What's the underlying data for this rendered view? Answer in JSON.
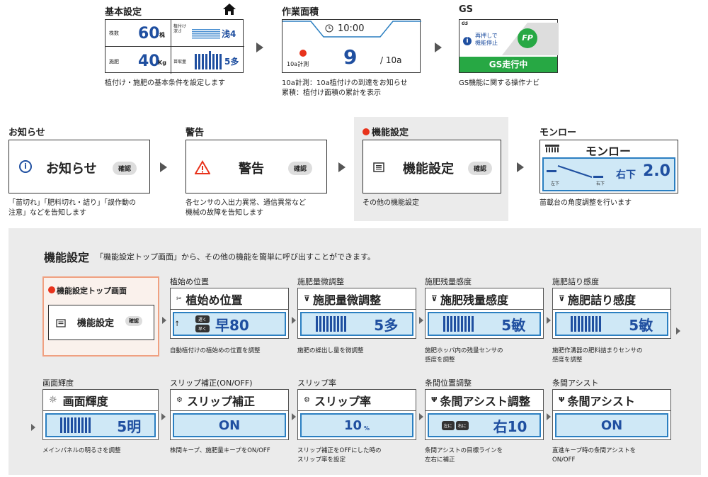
{
  "top": {
    "basic": {
      "title": "基本設定",
      "r1_label": "株数",
      "r1_value": "60",
      "r1_unit": "株",
      "r1b_label": "植付け\n深さ",
      "r1b_value": "浅4",
      "r2_label": "施肥",
      "r2_value": "40",
      "r2_unit": "Kg",
      "r2b_label": "苗取量",
      "r2b_value": "5多",
      "caption": "植付け・施肥の基本条件を設定します"
    },
    "area": {
      "title": "作業面積",
      "time": "10:00",
      "label": "10a計測",
      "value": "9",
      "unit": "/ 10a",
      "caption1": "10a計測：10a植付けの到達をお知らせ",
      "caption2": "累積：植付け面積の累計を表示"
    },
    "gs": {
      "title": "GS",
      "corner": "GS",
      "msg1": "再押しで",
      "msg2": "機能停止",
      "logo": "FP",
      "status": "GS走行中",
      "caption": "GS機能に関する操作ナビ"
    }
  },
  "middle": {
    "notice": {
      "title": "お知らせ",
      "label": "お知らせ",
      "badge": "確認",
      "caption1": "「苗切れ」「肥料切れ・詰り」「誤作動の",
      "caption2": "注意」などを告知します"
    },
    "warning": {
      "title": "警告",
      "label": "警告",
      "badge": "確認",
      "caption1": "各センサの入出力異常、通信異常など",
      "caption2": "機械の故障を告知します"
    },
    "func": {
      "title": "機能設定",
      "label": "機能設定",
      "badge": "確認",
      "caption": "その他の機能設定"
    },
    "monroe": {
      "title": "モンロー",
      "label": "モンロー",
      "left": "左下",
      "right": "右下",
      "dir": "右下",
      "value": "2.0",
      "caption": "苗載台の角度調整を行います"
    }
  },
  "bottom": {
    "heading": "機能設定",
    "heading_sub": "「機能設定トップ画面」から、その他の機能を簡単に呼び出すことができます。",
    "top_screen": {
      "title": "機能設定トップ画面",
      "label": "機能設定",
      "badge": "確認"
    },
    "row1": [
      {
        "title": "植始め位置",
        "screen": "植始め位置",
        "value": "早80",
        "slow": "遅く",
        "fast": "早く",
        "caption1": "自動植付けの植始めの位置を調整",
        "caption2": ""
      },
      {
        "title": "施肥量微調整",
        "screen": "施肥量微調整",
        "value": "5多",
        "caption1": "施肥の繰出し量を微調整",
        "caption2": ""
      },
      {
        "title": "施肥残量感度",
        "screen": "施肥残量感度",
        "value": "5敏",
        "caption1": "施肥ホッパ内の残量センサの",
        "caption2": "感度を調整"
      },
      {
        "title": "施肥詰り感度",
        "screen": "施肥詰り感度",
        "value": "5敏",
        "caption1": "施肥作溝器の肥料詰まりセンサの",
        "caption2": "感度を調整"
      }
    ],
    "row2": [
      {
        "title": "画面輝度",
        "screen": "画面輝度",
        "value": "5明",
        "caption1": "メインパネルの明るさを調整",
        "caption2": ""
      },
      {
        "title": "スリップ補正(ON/OFF)",
        "screen": "スリップ補正",
        "value": "ON",
        "caption1": "株間キープ、施肥量キープをON/OFF",
        "caption2": ""
      },
      {
        "title": "スリップ率",
        "screen": "スリップ率",
        "value": "10",
        "unit": "%",
        "caption1": "スリップ補正をOFFにした時の",
        "caption2": "スリップ率を設定"
      },
      {
        "title": "条間位置調整",
        "screen": "条間アシスト調整",
        "value": "右10",
        "left": "左に",
        "right": "右に",
        "caption1": "条間アシストの目標ラインを",
        "caption2": "左右に補正"
      },
      {
        "title": "条間アシスト",
        "screen": "条間アシスト",
        "value": "ON",
        "caption1": "直進キープ時の条間アシストを",
        "caption2": "ON/OFF"
      }
    ]
  },
  "colors": {
    "accent": "#1f4fa0",
    "red": "#e8331c",
    "green": "#27a844",
    "lcd_blue": "#cfe8f6"
  }
}
